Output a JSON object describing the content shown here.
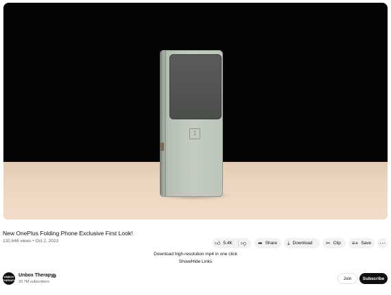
{
  "video": {
    "title": "New OnePlus Folding Phone Exclusive First Look!",
    "views": "132,646 views",
    "date": "Oct 2, 2023"
  },
  "actions": {
    "like_icon": "thumbs-up-icon",
    "like_count": "5.4K",
    "dislike_icon": "thumbs-down-icon",
    "share_icon": "share-arrow-icon",
    "share_label": "Share",
    "download_icon": "download-icon",
    "download_label": "Download",
    "clip_icon": "scissors-icon",
    "clip_label": "Clip",
    "save_icon": "playlist-add-icon",
    "save_label": "Save",
    "more_icon": "more-horizontal-icon"
  },
  "promo": {
    "download_text": "Download high-resolution mp4 in one click",
    "links_text": "Show/Hide Links"
  },
  "channel": {
    "name": "Unbox Therapy",
    "verified_icon": "verified-check-icon",
    "subscribers": "20.7M subscribers",
    "join_label": "Join",
    "subscribe_label": "Subscribe"
  }
}
